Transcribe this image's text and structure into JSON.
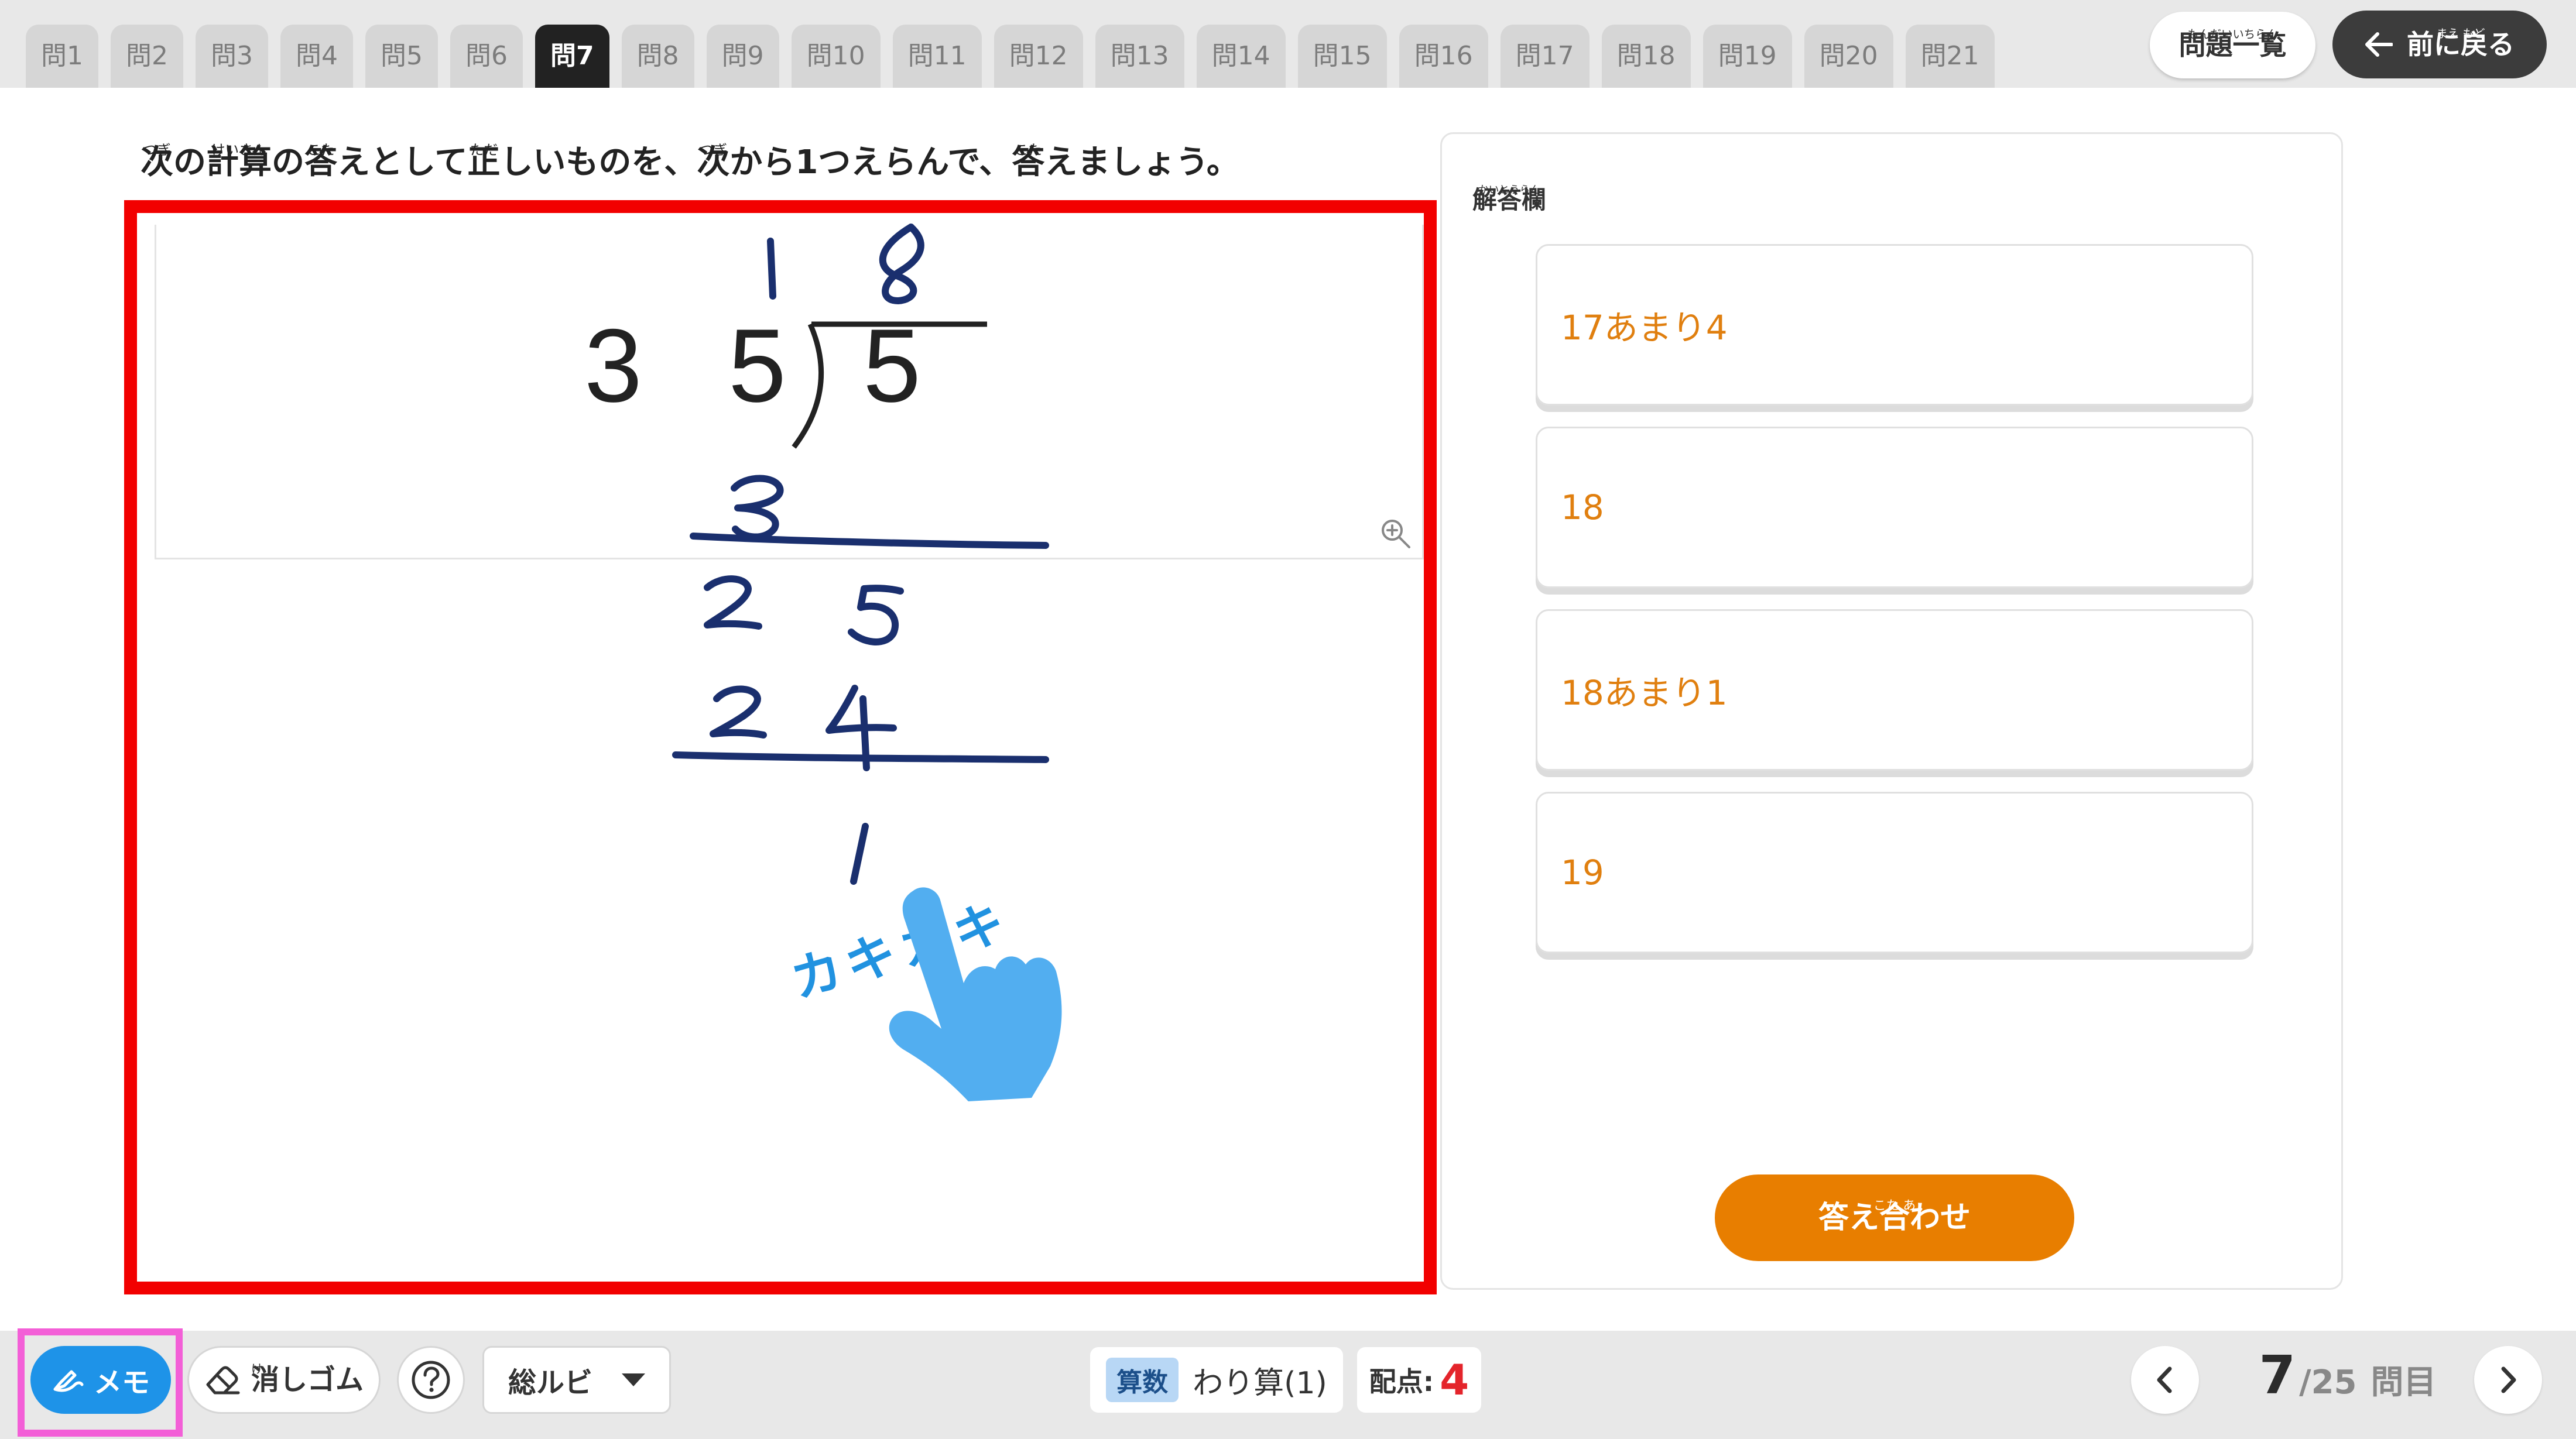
{
  "tabs": {
    "items": [
      "問1",
      "問2",
      "問3",
      "問4",
      "問5",
      "問6",
      "問7",
      "問8",
      "問9",
      "問10",
      "問11",
      "問12",
      "問13",
      "問14",
      "問15",
      "問16",
      "問17",
      "問18",
      "問19",
      "問20",
      "問21"
    ],
    "active_index": 6
  },
  "header": {
    "list_button": {
      "label": "問題一覧",
      "ruby": "もんだいいちらん"
    },
    "back_button": {
      "label": "前に戻る",
      "ruby": "まえ もど"
    }
  },
  "question": {
    "parts": [
      {
        "t": "次",
        "r": "つぎ"
      },
      {
        "t": "の"
      },
      {
        "t": "計算",
        "r": "けいさん"
      },
      {
        "t": "の"
      },
      {
        "t": "答",
        "r": "こた"
      },
      {
        "t": "えとして"
      },
      {
        "t": "正",
        "r": "ただ"
      },
      {
        "t": "しいものを、"
      },
      {
        "t": "次",
        "r": "つぎ"
      },
      {
        "t": "から1つえらんで、"
      },
      {
        "t": "答",
        "r": "こた"
      },
      {
        "t": "えましょう。"
      }
    ]
  },
  "work": {
    "problem": {
      "divisor": "3",
      "dividend": [
        "5",
        "5"
      ]
    },
    "annotation": "カキカキ",
    "zoom_icon": "zoom-in-icon",
    "hand_icon": "pointing-hand-icon",
    "ink_color": "#1a2f6e",
    "frame_color": "#f20000"
  },
  "answer_panel": {
    "title": "解答欄",
    "title_ruby": "かいとうらん",
    "choices": [
      "17あまり4",
      "18",
      "18あまり1",
      "19"
    ],
    "submit": {
      "label": "答え合わせ",
      "ruby": "こた あ"
    },
    "accent_color": "#e87e00"
  },
  "toolbar": {
    "memo_label": "メモ",
    "eraser_label": "消しゴム",
    "eraser_ruby": "け",
    "help_icon": "help-icon",
    "ruby_select": "総ルビ",
    "subject": "算数",
    "unit": "わり算(1)",
    "score_label": "配点:",
    "score_value": "4",
    "current": "7",
    "total": "/25",
    "suffix": "問目",
    "memo_color": "#1e93e8"
  }
}
